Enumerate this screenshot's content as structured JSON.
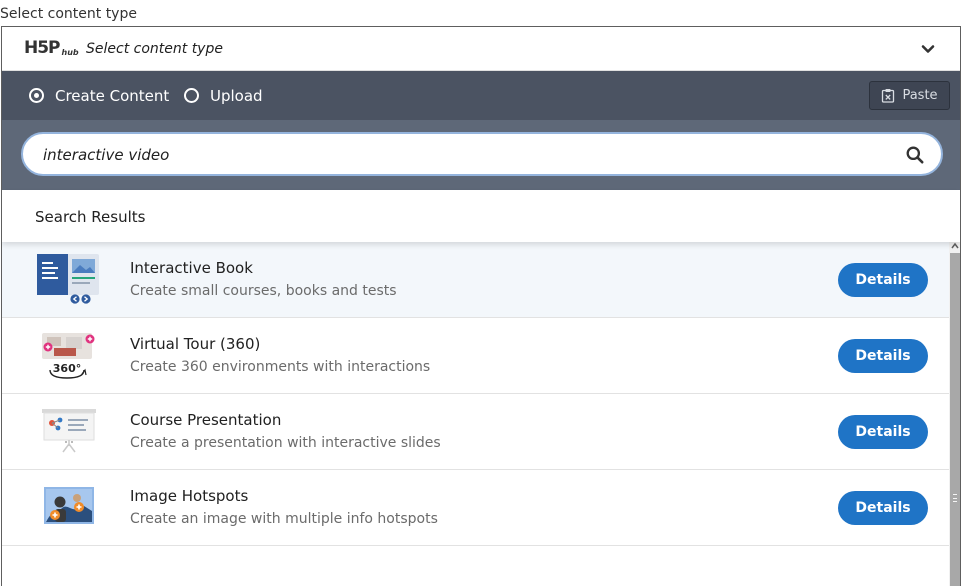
{
  "outer_label": "Select content type",
  "header": {
    "logo": "H5P",
    "logo_sub": "hub",
    "title": "Select content type"
  },
  "tabs": [
    {
      "label": "Create Content",
      "selected": true
    },
    {
      "label": "Upload",
      "selected": false
    }
  ],
  "paste_label": "Paste",
  "search": {
    "value": "interactive video",
    "placeholder": ""
  },
  "results_title": "Search Results",
  "results": [
    {
      "title": "Interactive Book",
      "description": "Create small courses, books and tests",
      "button": "Details",
      "icon": "interactive-book-icon"
    },
    {
      "title": "Virtual Tour (360)",
      "description": "Create 360 environments with interactions",
      "button": "Details",
      "icon": "virtual-tour-icon"
    },
    {
      "title": "Course Presentation",
      "description": "Create a presentation with interactive slides",
      "button": "Details",
      "icon": "course-presentation-icon"
    },
    {
      "title": "Image Hotspots",
      "description": "Create an image with multiple info hotspots",
      "button": "Details",
      "icon": "image-hotspots-icon"
    }
  ],
  "virtual_tour_badge": "360°",
  "colors": {
    "tabs_bar": "#4b5362",
    "search_band": "#5e6878",
    "details_button": "#1f74c6"
  }
}
